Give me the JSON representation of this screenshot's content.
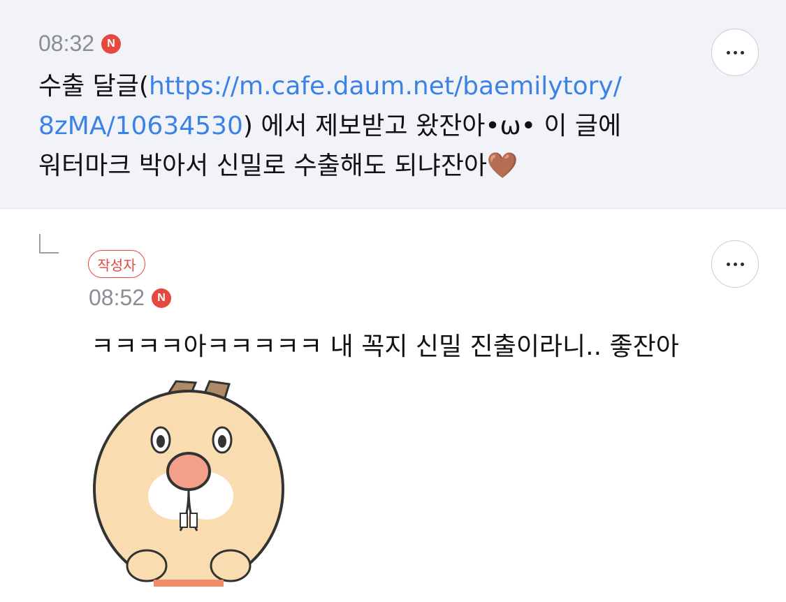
{
  "comments": [
    {
      "time": "08:32",
      "badge": "N",
      "text_before_link": "수출 달글(",
      "link_line1": "https://m.cafe.daum.net/baemilytory/",
      "link_line2": "8zMA/10634530",
      "text_after_link": ") 에서 제보받고 왔잔아•ω• 이 글에",
      "text_line3": "워터마크 박아서 신밀로 수출해도 되냐잔아🤎"
    },
    {
      "author_label": "작성자",
      "time": "08:52",
      "badge": "N",
      "text": "ㅋㅋㅋㅋ아ㅋㅋㅋㅋㅋ 내 꼭지 신밀 진출이라니.. 좋잔아"
    }
  ],
  "icons": {
    "more": "more-options-icon",
    "reply": "reply-arrow-icon",
    "sticker": "cartoon-character-sticker"
  },
  "colors": {
    "background_highlight": "#f1f3f8",
    "link": "#3b82e6",
    "accent_red": "#e4483f",
    "meta_gray": "#8a8d95"
  }
}
